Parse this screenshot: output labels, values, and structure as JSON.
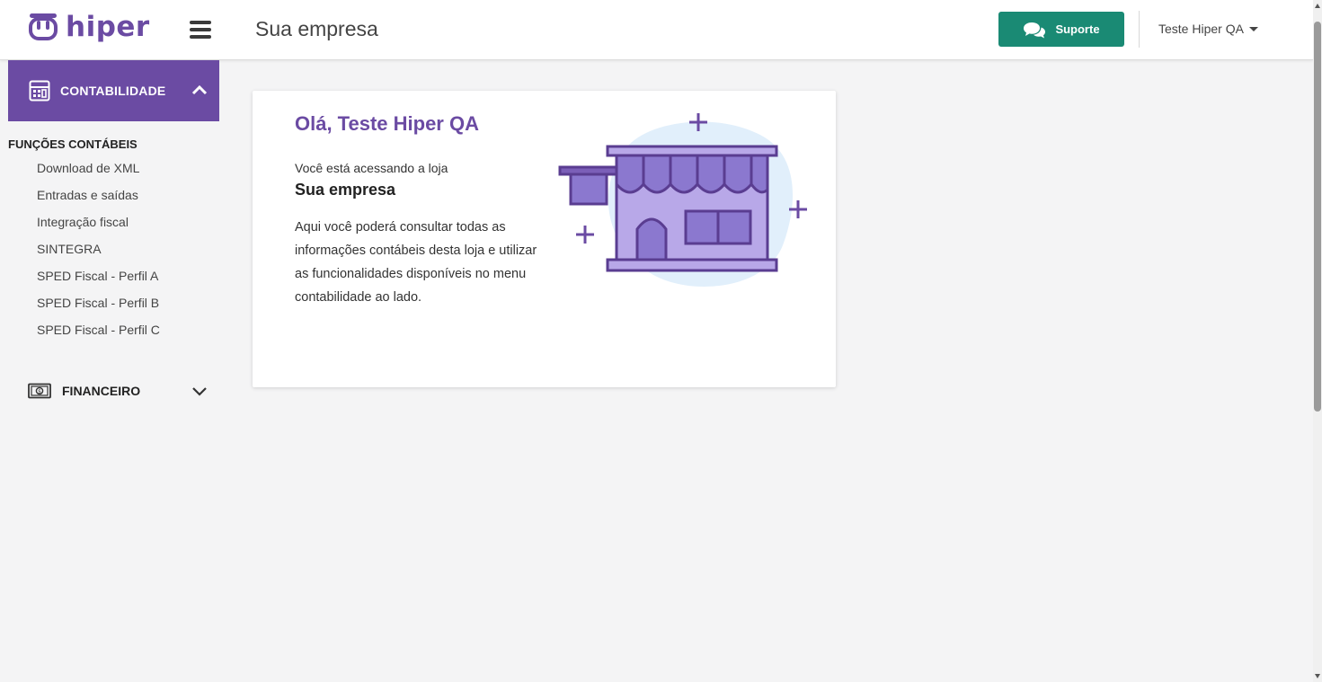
{
  "header": {
    "brand": "hiper",
    "page_title": "Sua empresa",
    "support_label": "Suporte",
    "user_name": "Teste Hiper QA",
    "accent_color": "#6b4ba3",
    "support_color": "#1a8a74"
  },
  "sidebar": {
    "contabilidade": {
      "label": "CONTABILIDADE",
      "icon": "calculator-icon",
      "expanded": true,
      "group_title": "FUNÇÕES CONTÁBEIS",
      "items": [
        {
          "label": "Download de XML"
        },
        {
          "label": "Entradas e saídas"
        },
        {
          "label": "Integração fiscal"
        },
        {
          "label": "SINTEGRA"
        },
        {
          "label": "SPED Fiscal - Perfil A"
        },
        {
          "label": "SPED Fiscal - Perfil B"
        },
        {
          "label": "SPED Fiscal - Perfil C"
        }
      ]
    },
    "financeiro": {
      "label": "FINANCEIRO",
      "icon": "money-bill-icon",
      "expanded": false
    }
  },
  "welcome_card": {
    "greeting": "Olá, Teste Hiper QA",
    "accessing_text": "Você está acessando a loja",
    "store_name": "Sua empresa",
    "description": "Aqui você poderá consultar todas as informações contábeis desta loja e utilizar as funcionalidades disponíveis no menu contabilidade ao lado.",
    "illustration": "storefront-illustration"
  }
}
